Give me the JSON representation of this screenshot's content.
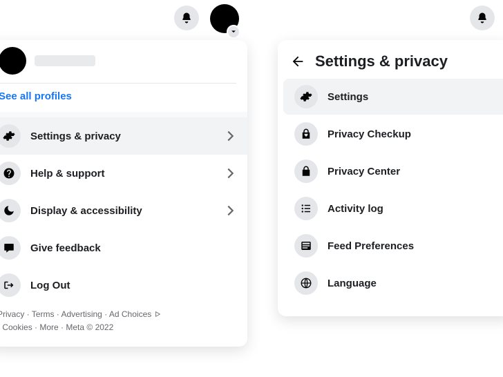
{
  "topbar_left": {},
  "profile": {
    "see_all": "See all profiles"
  },
  "menu_left": {
    "items": [
      {
        "label": "Settings & privacy",
        "icon": "gear-icon",
        "chevron": true,
        "selected": true
      },
      {
        "label": "Help & support",
        "icon": "help-icon",
        "chevron": true,
        "selected": false
      },
      {
        "label": "Display & accessibility",
        "icon": "moon-icon",
        "chevron": true,
        "selected": false
      },
      {
        "label": "Give feedback",
        "icon": "feedback-icon",
        "chevron": false,
        "selected": false
      },
      {
        "label": "Log Out",
        "icon": "logout-icon",
        "chevron": false,
        "selected": false
      }
    ]
  },
  "footer": {
    "segments": {
      "privacy": "Privacy",
      "terms": "Terms",
      "advertising": "Advertising",
      "adchoices": "Ad Choices",
      "cookies": "Cookies",
      "more": "More",
      "meta": "Meta © 2022"
    },
    "sep": " · "
  },
  "panel_right": {
    "title": "Settings & privacy",
    "items": [
      {
        "label": "Settings",
        "icon": "gear-icon",
        "selected": true
      },
      {
        "label": "Privacy Checkup",
        "icon": "lock-heart-icon",
        "selected": false
      },
      {
        "label": "Privacy Center",
        "icon": "lock-icon",
        "selected": false
      },
      {
        "label": "Activity log",
        "icon": "list-icon",
        "selected": false
      },
      {
        "label": "Feed Preferences",
        "icon": "feed-icon",
        "selected": false
      },
      {
        "label": "Language",
        "icon": "globe-icon",
        "selected": false
      }
    ]
  }
}
